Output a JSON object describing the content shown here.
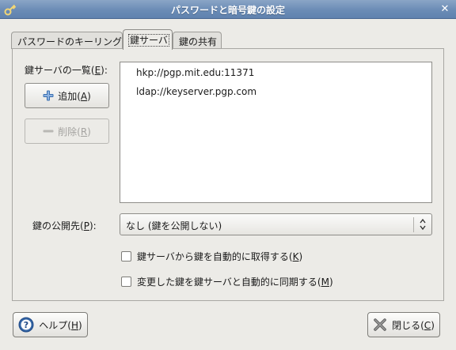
{
  "window": {
    "title": "パスワードと暗号鍵の設定",
    "app_icon": "key-icon",
    "close_icon": "close-icon"
  },
  "tabs": [
    {
      "label": "パスワードのキーリング",
      "active": false
    },
    {
      "label": "鍵サーバ",
      "active": true
    },
    {
      "label": "鍵の共有",
      "active": false
    }
  ],
  "keyserver_list": {
    "label_prefix": "鍵サーバの一覧(",
    "label_mnemonic": "E",
    "label_suffix": "):",
    "items": [
      "hkp://pgp.mit.edu:11371",
      "ldap://keyserver.pgp.com"
    ]
  },
  "buttons": {
    "add": {
      "icon": "plus-icon",
      "label_text": "追加(",
      "mnemonic": "A",
      "label_end": ")"
    },
    "remove": {
      "icon": "minus-icon",
      "label_text": "削除(",
      "mnemonic": "R",
      "label_end": ")",
      "disabled": true
    }
  },
  "publish": {
    "label_prefix": "鍵の公開先(",
    "label_mnemonic": "P",
    "label_suffix": "):",
    "selected": "なし (鍵を公開しない)"
  },
  "checkboxes": [
    {
      "text": "鍵サーバから鍵を自動的に取得する(",
      "mnemonic": "K",
      "end": ")",
      "checked": false
    },
    {
      "text": "変更した鍵を鍵サーバと自動的に同期する(",
      "mnemonic": "M",
      "end": ")",
      "checked": false
    }
  ],
  "footer": {
    "help": {
      "icon": "help-icon",
      "label_text": "ヘルプ(",
      "mnemonic": "H",
      "label_end": ")"
    },
    "close": {
      "icon": "close-x-icon",
      "label_text": "閉じる(",
      "mnemonic": "C",
      "label_end": ")"
    }
  },
  "colors": {
    "titlebar": "#6b8cb6",
    "help_icon_blue": "#3465a4",
    "plus_icon_blue": "#3a6fb0"
  }
}
